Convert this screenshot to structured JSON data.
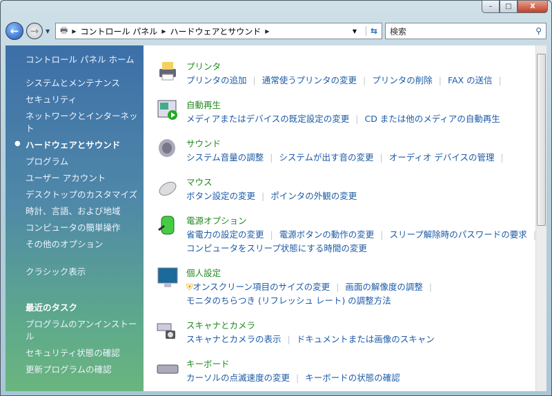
{
  "window": {
    "minimize": "–",
    "maximize": "□",
    "close": "X"
  },
  "address": {
    "crumbs": [
      "コントロール パネル",
      "ハードウェアとサウンド"
    ],
    "search_placeholder": "検索"
  },
  "sidebar": {
    "items": [
      {
        "label": "コントロール パネル ホーム"
      },
      {
        "label": "システムとメンテナンス"
      },
      {
        "label": "セキュリティ"
      },
      {
        "label": "ネットワークとインターネット"
      },
      {
        "label": "ハードウェアとサウンド",
        "current": true
      },
      {
        "label": "プログラム"
      },
      {
        "label": "ユーザー アカウント"
      },
      {
        "label": "デスクトップのカスタマイズ"
      },
      {
        "label": "時計、言語、および地域"
      },
      {
        "label": "コンピュータの簡単操作"
      },
      {
        "label": "その他のオプション"
      },
      {
        "label": "クラシック表示"
      }
    ],
    "recent_title": "最近のタスク",
    "recent": [
      "プログラムのアンインストール",
      "セキュリティ状態の確認",
      "更新プログラムの確認"
    ]
  },
  "categories": [
    {
      "title": "プリンタ",
      "icon": "printer-icon",
      "lines": [
        [
          "プリンタの追加",
          "通常使うプリンタの変更",
          "プリンタの削除",
          "FAX の送信"
        ]
      ]
    },
    {
      "title": "自動再生",
      "icon": "autoplay-icon",
      "lines": [
        [
          "メディアまたはデバイスの既定設定の変更",
          "CD または他のメディアの自動再生"
        ]
      ]
    },
    {
      "title": "サウンド",
      "icon": "speaker-icon",
      "lines": [
        [
          "システム音量の調整",
          "システムが出す音の変更",
          "オーディオ デバイスの管理"
        ]
      ]
    },
    {
      "title": "マウス",
      "icon": "mouse-icon",
      "lines": [
        [
          "ボタン設定の変更",
          "ポインタの外観の変更"
        ]
      ]
    },
    {
      "title": "電源オプション",
      "icon": "battery-icon",
      "lines": [
        [
          "省電力の設定の変更",
          "電源ボタンの動作の変更",
          "スリープ解除時のパスワードの要求"
        ],
        [
          "コンピュータをスリープ状態にする時間の変更"
        ]
      ]
    },
    {
      "title": "個人設定",
      "icon": "monitor-icon",
      "lines": [
        [
          "オンスクリーン項目のサイズの変更",
          "画面の解像度の調整"
        ],
        [
          "モニタのちらつき (リフレッシュ レート) の調整方法"
        ]
      ]
    },
    {
      "title": "スキャナとカメラ",
      "icon": "scanner-icon",
      "lines": [
        [
          "スキャナとカメラの表示",
          "ドキュメントまたは画像のスキャン"
        ]
      ]
    },
    {
      "title": "キーボード",
      "icon": "keyboard-icon",
      "lines": [
        [
          "カーソルの点滅速度の変更",
          "キーボードの状態の確認"
        ]
      ]
    }
  ]
}
